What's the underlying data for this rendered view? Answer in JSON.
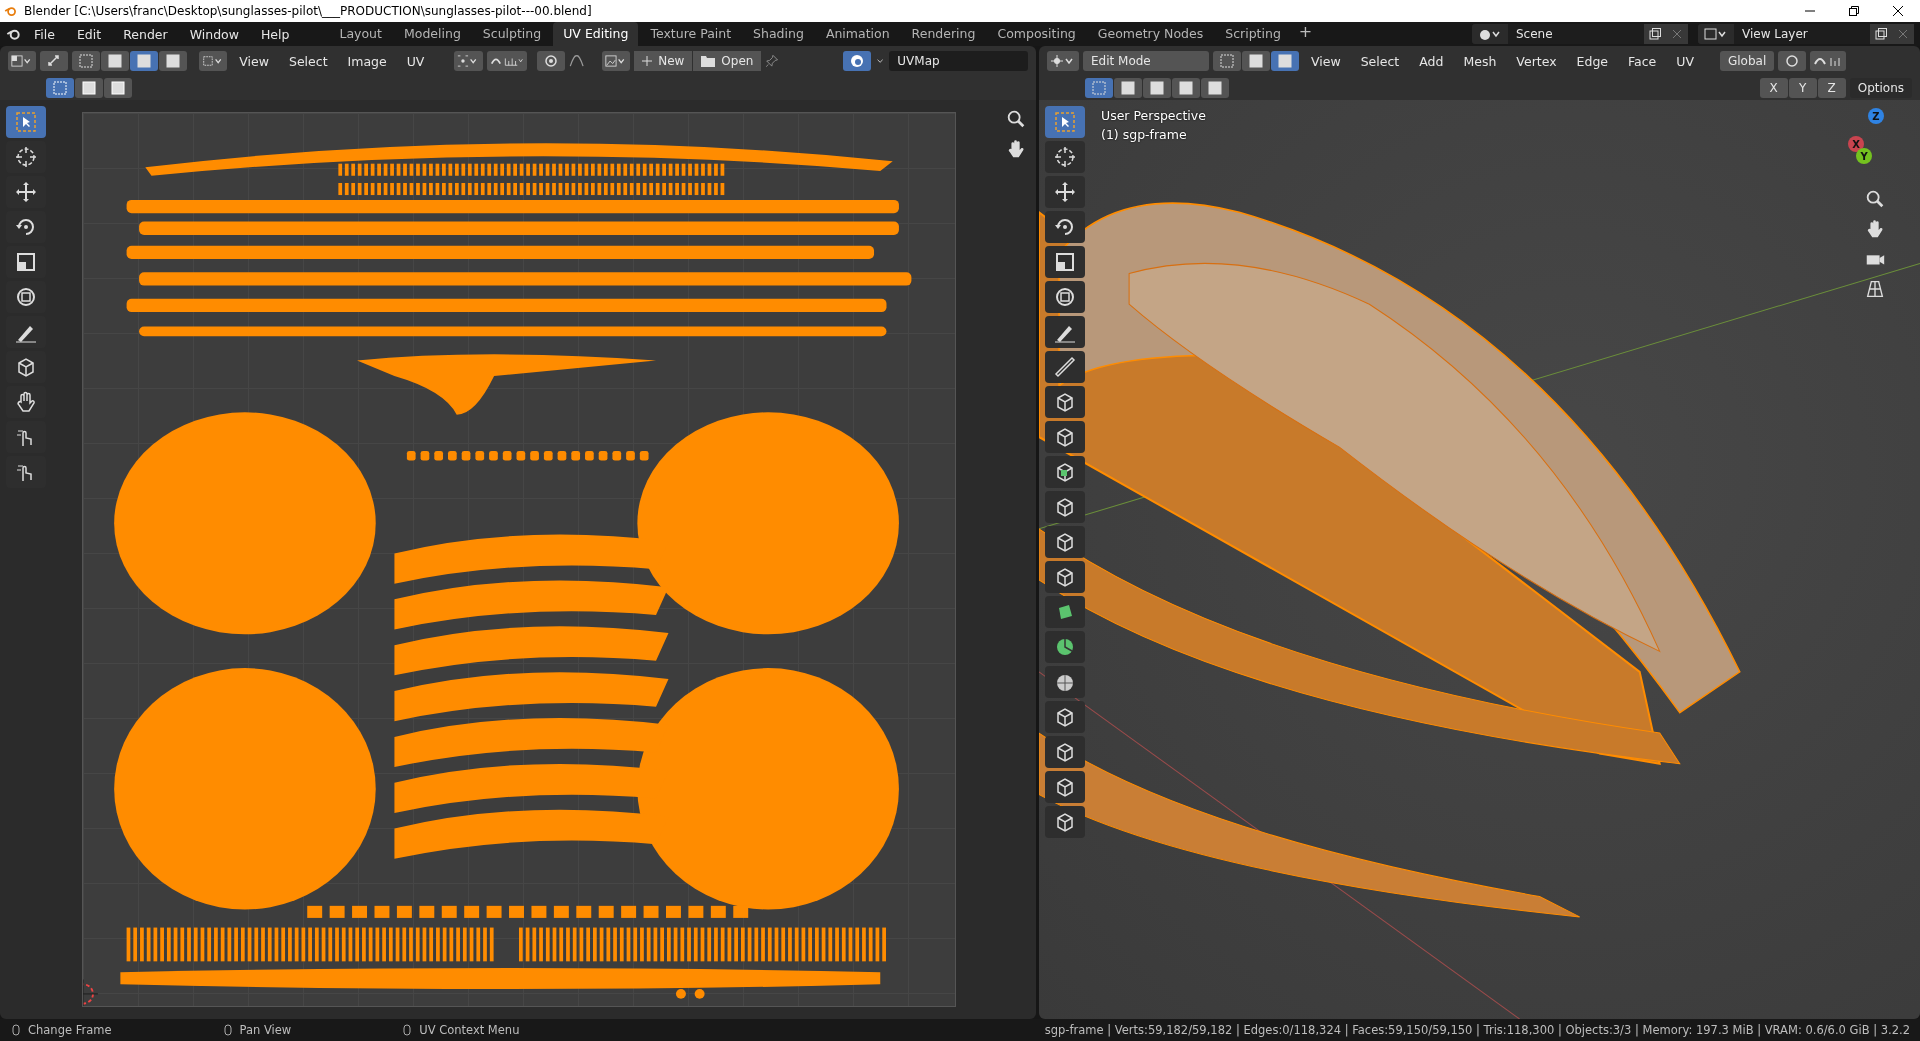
{
  "window": {
    "title": "Blender [C:\\Users\\franc\\Desktop\\sunglasses-pilot\\___PRODUCTION\\sunglasses-pilot---00.blend]"
  },
  "menu": [
    "File",
    "Edit",
    "Render",
    "Window",
    "Help"
  ],
  "workspaces": [
    {
      "label": "Layout",
      "selected": false
    },
    {
      "label": "Modeling",
      "selected": false
    },
    {
      "label": "Sculpting",
      "selected": false
    },
    {
      "label": "UV Editing",
      "selected": true
    },
    {
      "label": "Texture Paint",
      "selected": false
    },
    {
      "label": "Shading",
      "selected": false
    },
    {
      "label": "Animation",
      "selected": false
    },
    {
      "label": "Rendering",
      "selected": false
    },
    {
      "label": "Compositing",
      "selected": false
    },
    {
      "label": "Geometry Nodes",
      "selected": false
    },
    {
      "label": "Scripting",
      "selected": false
    }
  ],
  "add_workspace": "+",
  "scene": "Scene",
  "view_layer": "View Layer",
  "uv_editor": {
    "select_modes": [
      {
        "selected": false
      },
      {
        "selected": false
      },
      {
        "selected": true
      },
      {
        "selected": false
      }
    ],
    "menus": [
      "View",
      "Select",
      "Image",
      "UV"
    ],
    "new_button": "New",
    "open_button": "Open",
    "uv_map": "UVMap",
    "sticky_modes": [
      {
        "selected": true
      },
      {
        "selected": false
      },
      {
        "selected": false
      }
    ],
    "tools": [
      {
        "kind": "select",
        "selected": true
      },
      {
        "kind": "cursor",
        "selected": false
      },
      {
        "kind": "move",
        "selected": false
      },
      {
        "kind": "rotate",
        "selected": false
      },
      {
        "kind": "scale",
        "selected": false
      },
      {
        "kind": "transform",
        "selected": false
      },
      {
        "kind": "annotate",
        "selected": false
      },
      {
        "kind": "rip",
        "selected": false
      },
      {
        "kind": "grab",
        "selected": false
      },
      {
        "kind": "relax",
        "selected": false
      },
      {
        "kind": "pinch",
        "selected": false
      }
    ]
  },
  "viewport": {
    "mode": "Edit Mode",
    "mesh_modes": [
      {
        "selected": false
      },
      {
        "selected": false
      },
      {
        "selected": true
      }
    ],
    "menus": [
      "View",
      "Select",
      "Add",
      "Mesh",
      "Vertex",
      "Edge",
      "Face",
      "UV"
    ],
    "orientation": "Global",
    "mirror_axes": [
      "X",
      "Y",
      "Z"
    ],
    "options": "Options",
    "overlay_lines": [
      "User Perspective",
      "(1) sgp-frame"
    ],
    "gizmo": {
      "z": "Z",
      "y": "Y",
      "x": "X"
    },
    "edit_select_modes": [
      {
        "selected": true
      },
      {
        "selected": false
      },
      {
        "selected": false
      },
      {
        "selected": false
      },
      {
        "selected": false
      }
    ],
    "tools": [
      {
        "kind": "select",
        "selected": true
      },
      {
        "kind": "cursor",
        "selected": false
      },
      {
        "kind": "move",
        "selected": false
      },
      {
        "kind": "rotate",
        "selected": false
      },
      {
        "kind": "scale",
        "selected": false
      },
      {
        "kind": "transform",
        "selected": false
      },
      {
        "kind": "annotate",
        "selected": false
      },
      {
        "kind": "measure",
        "selected": false
      },
      {
        "kind": "add-cube",
        "selected": false
      },
      {
        "kind": "extrude",
        "selected": false
      },
      {
        "kind": "inset",
        "selected": false
      },
      {
        "kind": "bevel",
        "selected": false
      },
      {
        "kind": "loop-cut",
        "selected": false
      },
      {
        "kind": "knife",
        "selected": false
      },
      {
        "kind": "poly-build",
        "selected": false
      },
      {
        "kind": "spin",
        "selected": false
      },
      {
        "kind": "smooth",
        "selected": false
      },
      {
        "kind": "edge-slide",
        "selected": false
      },
      {
        "kind": "shrink",
        "selected": false
      },
      {
        "kind": "shear",
        "selected": false
      },
      {
        "kind": "rip",
        "selected": false
      }
    ]
  },
  "status_bar": {
    "hints": [
      "Change Frame",
      "Pan View",
      "UV Context Menu"
    ],
    "stats": "sgp-frame | Verts:59,182/59,182 | Edges:0/118,324 | Faces:59,150/59,150 | Tris:118,300 | Objects:3/3 | Memory: 197.3 MiB | VRAM: 0.6/6.0 GiB | 3.2.2"
  }
}
